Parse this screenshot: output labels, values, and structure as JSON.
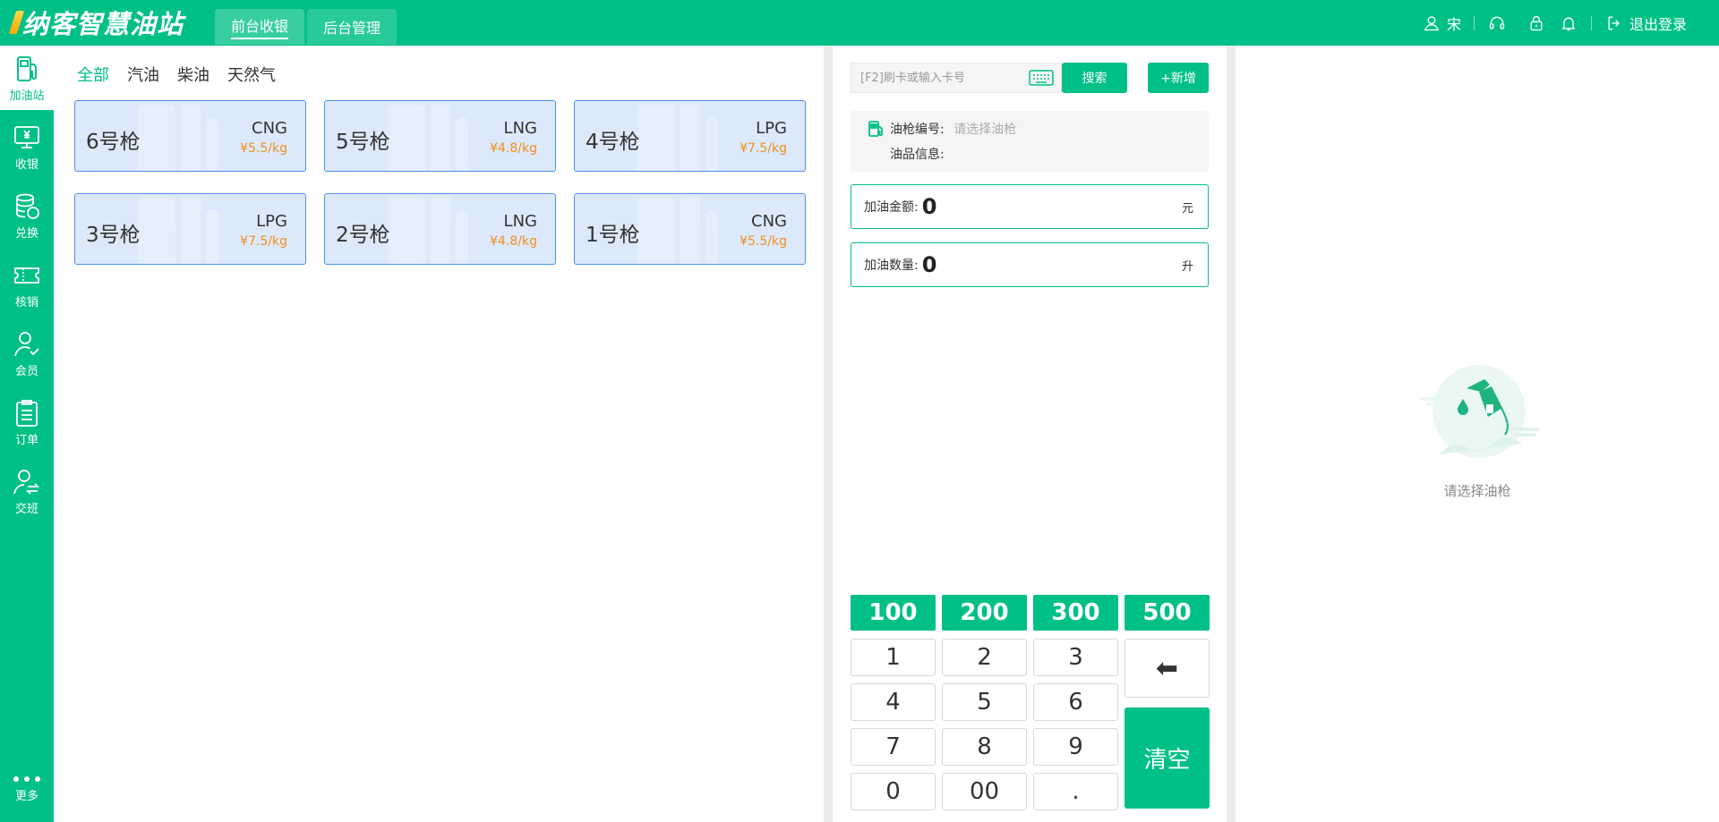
{
  "header": {
    "logo_text": "纳客智慧油站",
    "tabs": [
      {
        "label": "前台收银",
        "active": true
      },
      {
        "label": "后台管理",
        "active": false
      }
    ],
    "user_name": "宋",
    "logout_label": "退出登录",
    "icons": [
      "user-icon",
      "headset-icon",
      "lock-icon",
      "bell-icon",
      "logout-icon"
    ]
  },
  "sidebar": {
    "items": [
      {
        "label": "加油站",
        "icon": "fuel-pump-icon",
        "active": true
      },
      {
        "label": "收银",
        "icon": "cashier-monitor-icon",
        "active": false
      },
      {
        "label": "兑换",
        "icon": "coins-stack-icon",
        "active": false
      },
      {
        "label": "核销",
        "icon": "ticket-icon",
        "active": false
      },
      {
        "label": "会员",
        "icon": "member-icon",
        "active": false
      },
      {
        "label": "订单",
        "icon": "order-clipboard-icon",
        "active": false
      },
      {
        "label": "交班",
        "icon": "shift-change-icon",
        "active": false
      }
    ],
    "more_label": "更多"
  },
  "filters": [
    {
      "label": "全部",
      "active": true
    },
    {
      "label": "汽油",
      "active": false
    },
    {
      "label": "柴油",
      "active": false
    },
    {
      "label": "天然气",
      "active": false
    }
  ],
  "guns": [
    {
      "name": "6号枪",
      "type": "CNG",
      "price": "¥5.5/kg"
    },
    {
      "name": "5号枪",
      "type": "LNG",
      "price": "¥4.8/kg"
    },
    {
      "name": "4号枪",
      "type": "LPG",
      "price": "¥7.5/kg"
    },
    {
      "name": "3号枪",
      "type": "LPG",
      "price": "¥7.5/kg"
    },
    {
      "name": "2号枪",
      "type": "LNG",
      "price": "¥4.8/kg"
    },
    {
      "name": "1号枪",
      "type": "CNG",
      "price": "¥5.5/kg"
    }
  ],
  "search": {
    "placeholder": "[F2]刷卡或输入卡号",
    "search_label": "搜索",
    "add_label": "+新增"
  },
  "gun_info": {
    "number_label": "油枪编号:",
    "number_placeholder": "请选择油枪",
    "oil_label": "油品信息:"
  },
  "amount": {
    "label": "加油金额:",
    "value": "0",
    "unit": "元"
  },
  "quantity": {
    "label": "加油数量:",
    "value": "0",
    "unit": "升"
  },
  "quick_amounts": [
    "100",
    "200",
    "300",
    "500"
  ],
  "keypad": {
    "keys": [
      "1",
      "2",
      "3",
      "4",
      "5",
      "6",
      "7",
      "8",
      "9",
      "0",
      "00",
      "."
    ],
    "backspace": "⬅",
    "clear_label": "清空"
  },
  "empty_state": {
    "text": "请选择油枪"
  },
  "colors": {
    "primary": "#00c087",
    "gun_bg": "#dce9fb",
    "gun_border": "#4f8ff3",
    "price": "#f08f1c"
  }
}
